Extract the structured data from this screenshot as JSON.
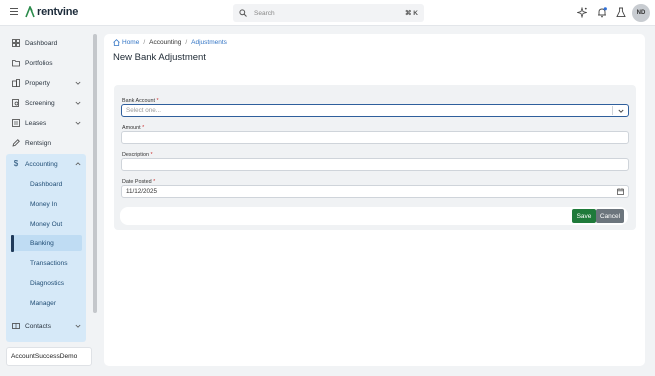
{
  "app": {
    "brand": "rentvine",
    "avatar_initials": "ND"
  },
  "search": {
    "placeholder": "Search",
    "shortcut": "⌘ K"
  },
  "topbar_icons": [
    "sparkle-icon",
    "bell-icon",
    "flask-icon"
  ],
  "sidebar": {
    "items": [
      {
        "label": "Dashboard",
        "icon": "dashboard-icon"
      },
      {
        "label": "Portfolios",
        "icon": "folder-icon"
      },
      {
        "label": "Property",
        "icon": "building-icon",
        "expandable": true
      },
      {
        "label": "Screening",
        "icon": "screening-icon",
        "expandable": true
      },
      {
        "label": "Leases",
        "icon": "lease-icon",
        "expandable": true
      },
      {
        "label": "Rentsign",
        "icon": "pen-icon"
      },
      {
        "label": "Accounting",
        "icon": "dollar-icon",
        "expanded": true
      },
      {
        "label": "Contacts",
        "icon": "contacts-icon",
        "expandable": true
      }
    ],
    "accounting_sub": [
      "Dashboard",
      "Money In",
      "Money Out",
      "Banking",
      "Transactions",
      "Diagnostics",
      "Manager"
    ],
    "active_sub": "Banking",
    "company": "AccountSuccessDemo"
  },
  "breadcrumb": [
    "Home",
    "Accounting",
    "Adjustments"
  ],
  "page": {
    "title": "New Bank Adjustment"
  },
  "form": {
    "bank_account": {
      "label": "Bank Account",
      "placeholder": "Select one..."
    },
    "amount": {
      "label": "Amount",
      "value": ""
    },
    "description": {
      "label": "Description",
      "value": ""
    },
    "date_posted": {
      "label": "Date Posted",
      "value": "11/12/2025"
    },
    "required_mark": "*",
    "save": "Save",
    "cancel": "Cancel"
  },
  "colors": {
    "accent": "#3375c5",
    "save": "#1f7a3a",
    "cancel": "#6c757d",
    "nav_active_bg": "#d6e9f8"
  }
}
